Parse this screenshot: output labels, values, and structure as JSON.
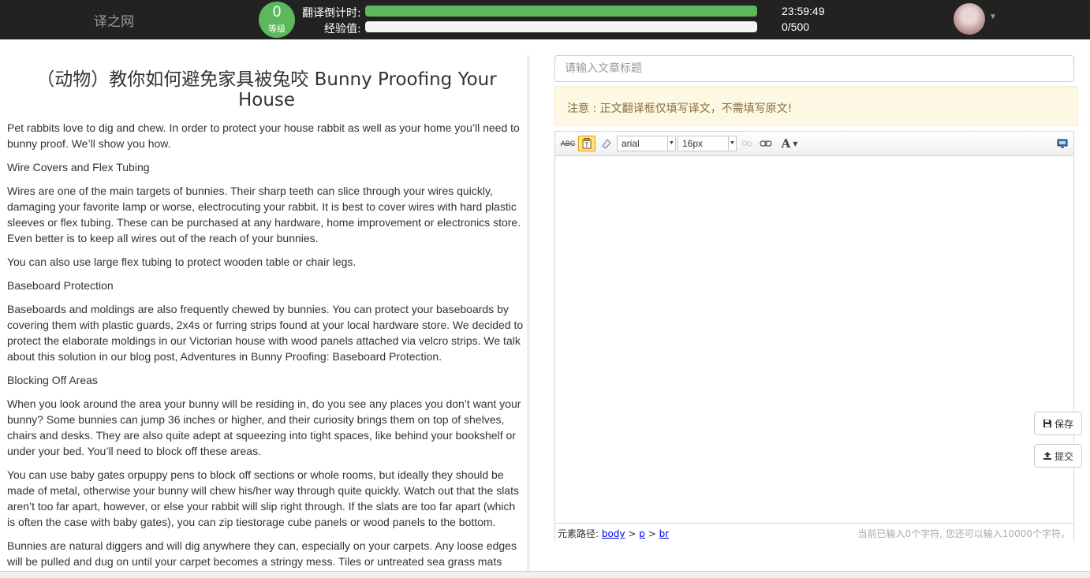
{
  "topbar": {
    "logo": "译之网",
    "level": {
      "value": "0",
      "label": "等级"
    },
    "countdown": {
      "label": "翻译倒计时:",
      "value": "23:59:49",
      "progress": 1.0
    },
    "experience": {
      "label": "经验值:",
      "value": "0/500",
      "progress": 0.0
    },
    "avatar_icon": "avatar-photo",
    "menu_icon": "caret-down"
  },
  "article": {
    "title": "（动物）教你如何避免家具被兔咬 Bunny Proofing Your House",
    "paragraphs": [
      "Pet rabbits love to dig and chew. In order to protect your house rabbit as well as your home you’ll need to bunny proof. We’ll show you how.",
      "Wire Covers and Flex Tubing",
      "Wires are one of the main targets of bunnies. Their sharp teeth can slice through your wires quickly, damaging your favorite lamp or worse, electrocuting your rabbit. It is best to cover wires with hard plastic sleeves or flex tubing. These can be purchased at any hardware, home improvement or electronics store. Even better is to keep all wires out of the reach of your bunnies.",
      "You can also use large flex tubing to protect wooden table or chair legs.",
      "Baseboard Protection",
      "Baseboards and moldings are also frequently chewed by bunnies. You can protect your baseboards by covering them with plastic guards, 2x4s or furring strips found at your local hardware store. We decided to protect the elaborate moldings in our Victorian house with wood panels attached via velcro strips. We talk about this solution in our blog post, Adventures in Bunny Proofing: Baseboard Protection.",
      "Blocking Off Areas",
      "When you look around the area your bunny will be residing in, do you see any places you don’t want your bunny? Some bunnies can jump 36 inches or higher, and their curiosity brings them on top of shelves, chairs and desks. They are also quite adept at squeezing into tight spaces, like behind your bookshelf or under your bed. You’ll need to block off these areas.",
      "You can use baby gates orpuppy pens to block off sections or whole rooms, but ideally they should be made of metal, otherwise your bunny will chew his/her way through quite quickly. Watch out that the slats aren’t too far apart, however, or else your rabbit will slip right through. If the slats are too far apart (which is often the case with baby gates), you can zip tiestorage cube panels or wood panels to the bottom.",
      "Bunnies are natural diggers and will dig anywhere they can, especially on your carpets. Any loose edges will be pulled and dug on until your carpet becomes a stringy mess. Tiles or untreated sea grass mats"
    ]
  },
  "editor": {
    "title_placeholder": "请输入文章标题",
    "title_value": "",
    "notice": "注意 : 正文翻译框仅填写译文，不需填写原文!",
    "toolbar": {
      "spellcheck_label": "ABC",
      "font_family": "arial",
      "font_size": "16px",
      "font_color_label": "A"
    },
    "status": {
      "path_label": "元素路径:",
      "path_items": [
        "body",
        "p",
        "br"
      ],
      "separator": ">",
      "word_count": "当前已输入0个字符, 您还可以输入10000个字符。"
    }
  },
  "actions": {
    "save_label": "保存",
    "submit_label": "提交"
  },
  "colors": {
    "topbar_bg": "#222222",
    "level_badge": "#5cb85c",
    "notice_bg": "#fcf8e3",
    "notice_text": "#8a6d3b"
  }
}
